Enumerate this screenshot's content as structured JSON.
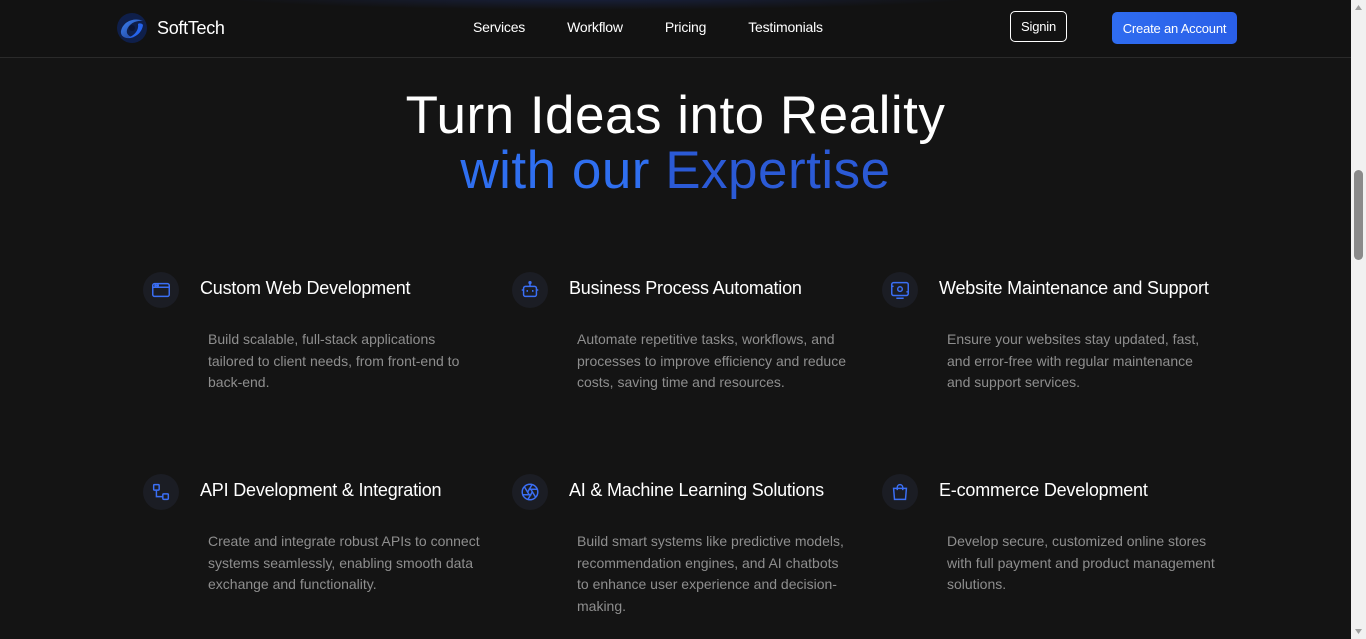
{
  "brand": {
    "name": "SoftTech",
    "logo_icon": "swirl-logo-icon",
    "accent": "#2f6ff0"
  },
  "nav": {
    "items": [
      {
        "label": "Services"
      },
      {
        "label": "Workflow"
      },
      {
        "label": "Pricing"
      },
      {
        "label": "Testimonials"
      }
    ],
    "signin_label": "Signin",
    "create_account_label": "Create an Account"
  },
  "hero": {
    "line1": "Turn Ideas into Reality",
    "line2_part1": "with our ",
    "line2_part2": "Expertise"
  },
  "services": [
    {
      "icon": "browser-window-icon",
      "title": "Custom Web Development",
      "description": "Build scalable, full-stack applications tailored to client needs, from front-end to back-end."
    },
    {
      "icon": "robot-icon",
      "title": "Business Process Automation",
      "description": "Automate repetitive tasks, workflows, and processes to improve efficiency and reduce costs, saving time and resources."
    },
    {
      "icon": "settings-screen-icon",
      "title": "Website Maintenance and Support",
      "description": "Ensure your websites stay updated, fast, and error-free with regular maintenance and support services."
    },
    {
      "icon": "connected-nodes-icon",
      "title": "API Development & Integration",
      "description": "Create and integrate robust APIs to connect systems seamlessly, enabling smooth data exchange and functionality."
    },
    {
      "icon": "aperture-icon",
      "title": "AI & Machine Learning Solutions",
      "description": "Build smart systems like predictive models, recommendation engines, and AI chatbots to enhance user experience and decision-making."
    },
    {
      "icon": "shopping-bag-icon",
      "title": "E-commerce Development",
      "description": "Develop secure, customized online stores with full payment and product management solutions."
    }
  ]
}
